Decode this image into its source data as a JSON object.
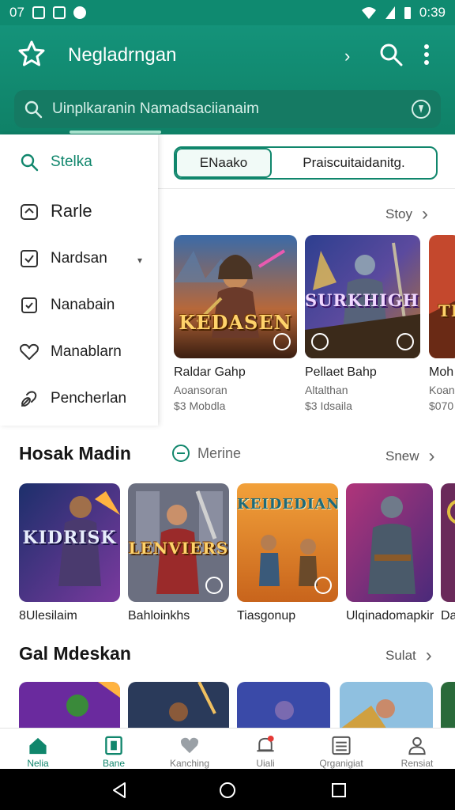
{
  "status_bar": {
    "time": "0:39",
    "left_label": "07"
  },
  "app_bar": {
    "title": "Negladrngan"
  },
  "search": {
    "query": "Uinplkaranin Namadsaciianaim"
  },
  "drawer": {
    "items": [
      {
        "label": "Stelka",
        "icon": "search-icon"
      },
      {
        "label": "Rarle",
        "icon": "home-icon"
      },
      {
        "label": "Nardsan",
        "icon": "checkbox-icon",
        "has_dropdown": true
      },
      {
        "label": "Nanabain",
        "icon": "checkbox-icon"
      },
      {
        "label": "Manablarn",
        "icon": "heart-icon"
      },
      {
        "label": "Pencherlan",
        "icon": "link-icon"
      }
    ]
  },
  "chips": {
    "active": "ENaako",
    "other": "Praiscuitaidanitg."
  },
  "featured": {
    "more_label": "Stoy",
    "cards": [
      {
        "logo": "KEDASEN",
        "name": "Raldar Gahp",
        "sub1": "Aoansoran",
        "sub2": "$3 Mobdla"
      },
      {
        "logo": "SURKHIGH!",
        "name": "Pellaet Bahp",
        "sub1": "Altalthan",
        "sub2": "$3 Idsaila"
      },
      {
        "logo": "TI",
        "name": "Moh",
        "sub1": "Koan",
        "sub2": "$070"
      }
    ]
  },
  "section2": {
    "title": "Hosak Madin",
    "link_label": "Merine",
    "more_label": "Snew",
    "tiles": [
      {
        "logo": "KIDRISK",
        "name": "8Ulesilaim"
      },
      {
        "logo": "LENVIERS",
        "name": "Bahloinkhs"
      },
      {
        "logo": "KEIDEDIAN",
        "name": "Tiasgonup"
      },
      {
        "logo": "",
        "name": "Ulqinadomapkir"
      },
      {
        "logo": "",
        "name": "Da"
      }
    ]
  },
  "section3": {
    "title": "Gal Mdeskan",
    "more_label": "Sulat"
  },
  "bottom_nav": [
    {
      "label": "Nelia",
      "icon": "home-icon"
    },
    {
      "label": "Bane",
      "icon": "apps-icon"
    },
    {
      "label": "Kanching",
      "icon": "heart-icon"
    },
    {
      "label": "Uiali",
      "icon": "notification-icon"
    },
    {
      "label": "Qrganigiat",
      "icon": "grid-icon"
    },
    {
      "label": "Rensiat",
      "icon": "profile-icon"
    }
  ],
  "colors": {
    "primary": "#10866c",
    "app_bar": "#14937a"
  }
}
